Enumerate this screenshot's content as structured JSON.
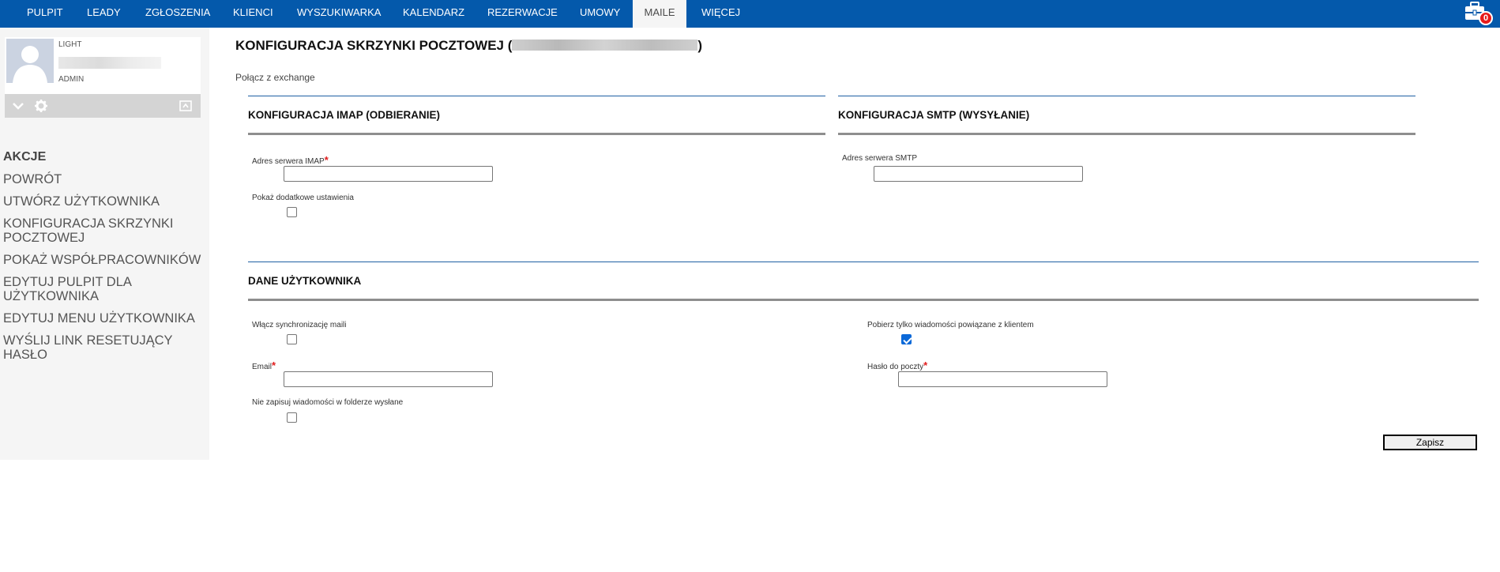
{
  "nav": {
    "items": [
      "PULPIT",
      "LEADY",
      "ZGŁOSZENIA",
      "KLIENCI",
      "WYSZUKIWARKA",
      "KALENDARZ",
      "REZERWACJE",
      "UMOWY",
      "MAILE",
      "WIĘCEJ"
    ],
    "active": "MAILE",
    "notification_count": "0",
    "colors": {
      "bar": "#0459ab",
      "badge": "#e81b1b"
    }
  },
  "user": {
    "role_top": "LIGHT",
    "role_bottom": "ADMIN"
  },
  "sidebar": {
    "heading": "AKCJE",
    "items": [
      "POWRÓT",
      "UTWÓRZ UŻYTKOWNIKA",
      "KONFIGURACJA SKRZYNKI POCZTOWEJ",
      "POKAŻ WSPÓŁPRACOWNIKÓW",
      "EDYTUJ PULPIT DLA UŻYTKOWNIKA",
      "EDYTUJ MENU UŻYTKOWNIKA",
      "WYŚLIJ LINK RESETUJĄCY HASŁO"
    ]
  },
  "page": {
    "title": "KONFIGURACJA SKRZYNKI POCZTOWEJ (",
    "title_close": ")",
    "exchange_link": "Połącz z exchange"
  },
  "imap": {
    "title": "KONFIGURACJA IMAP (ODBIERANIE)",
    "server_label": "Adres serwera IMAP",
    "server_value": "",
    "show_more_label": "Pokaż dodatkowe ustawienia",
    "show_more_checked": false
  },
  "smtp": {
    "title": "KONFIGURACJA SMTP (WYSYŁANIE)",
    "server_label": "Adres serwera SMTP",
    "server_value": ""
  },
  "userdata": {
    "title": "DANE UŻYTKOWNIKA",
    "sync_label": "Włącz synchronizację maili",
    "sync_checked": false,
    "client_only_label": "Pobierz tylko wiadomości powiązane z klientem",
    "client_only_checked": true,
    "email_label": "Email",
    "email_value": "",
    "password_label": "Hasło do poczty",
    "password_value": "",
    "no_save_sent_label": "Nie zapisuj wiadomości w folderze wysłane",
    "no_save_sent_checked": false
  },
  "actions": {
    "save": "Zapisz"
  },
  "required_marker": "*"
}
